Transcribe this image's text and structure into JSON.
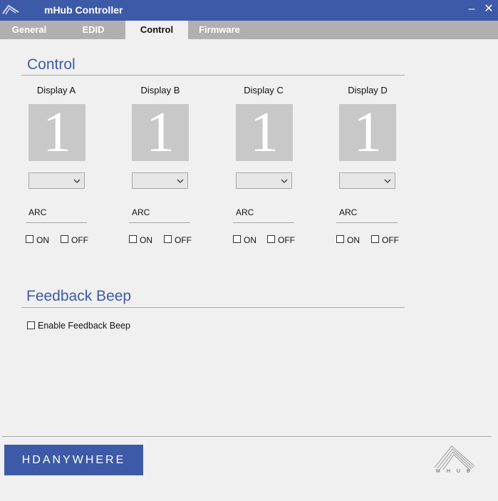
{
  "window": {
    "title": "mHub Controller",
    "minimize_glyph": "–",
    "close_glyph": "✕"
  },
  "tabs": [
    {
      "label": "General"
    },
    {
      "label": "EDID"
    },
    {
      "label": "Control",
      "active": true
    },
    {
      "label": "Firmware"
    }
  ],
  "control": {
    "title": "Control",
    "displays": [
      {
        "name": "Display A",
        "number": "1",
        "selected": "",
        "arc_label": "ARC",
        "on_label": "ON",
        "off_label": "OFF"
      },
      {
        "name": "Display B",
        "number": "1",
        "selected": "",
        "arc_label": "ARC",
        "on_label": "ON",
        "off_label": "OFF"
      },
      {
        "name": "Display C",
        "number": "1",
        "selected": "",
        "arc_label": "ARC",
        "on_label": "ON",
        "off_label": "OFF"
      },
      {
        "name": "Display D",
        "number": "1",
        "selected": "",
        "arc_label": "ARC",
        "on_label": "ON",
        "off_label": "OFF"
      }
    ]
  },
  "feedback": {
    "title": "Feedback Beep",
    "enable_label": "Enable Feedback Beep"
  },
  "footer": {
    "brand_button": "HDANYWHERE",
    "logo_text": "MHUB"
  },
  "colors": {
    "accent": "#3d5aa8",
    "tab_bar": "#b0b0b0",
    "background": "#f0f0f0",
    "display_box": "#c8c8c8"
  }
}
